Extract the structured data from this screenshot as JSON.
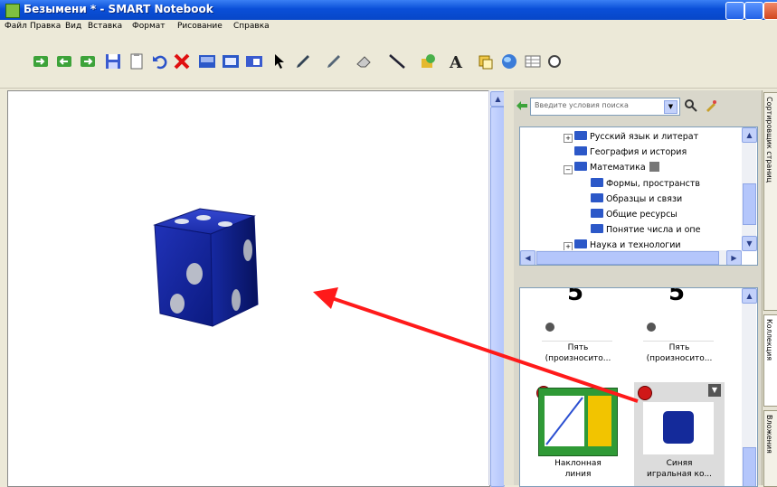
{
  "window": {
    "title": "Безымени * - SMART Notebook"
  },
  "menu": {
    "items": [
      "Файл",
      "Правка",
      "Вид",
      "Вставка",
      "Формат",
      "Рисование",
      "Справка"
    ]
  },
  "search": {
    "placeholder": "Введите условия поиска"
  },
  "tree": {
    "items": [
      "Русский язык и литерат",
      "География и история",
      "Математика",
      "Формы, пространств",
      "Образцы и связи",
      "Общие ресурсы",
      "Понятие числа и опе",
      "Наука и технологии"
    ]
  },
  "gallery": {
    "items": [
      {
        "label1": "Пять",
        "label2": "(произносито..."
      },
      {
        "label1": "Пять",
        "label2": "(произносито..."
      },
      {
        "label1": "Наклонная",
        "label2": "линия"
      },
      {
        "label1": "Синяя",
        "label2": "игральная ко..."
      }
    ],
    "digit": "5"
  },
  "side_tabs": [
    "Сортировщик страниц",
    "Коллекция",
    "Вложения"
  ],
  "colors": {
    "dice": "#142a9a",
    "arrow": "#ff1a1a",
    "titlebar": "#0a4fd8"
  },
  "icons": [
    "new-page-icon",
    "prev-page-icon",
    "next-page-icon",
    "save-icon",
    "paste-icon",
    "undo-icon",
    "delete-icon",
    "screen-shade-icon",
    "full-screen-icon",
    "capture-icon",
    "select-icon",
    "pen-icon",
    "creative-pen-icon",
    "eraser-icon",
    "line-icon",
    "shape-icon",
    "text-icon",
    "fill-icon",
    "globe-icon",
    "table-icon"
  ]
}
